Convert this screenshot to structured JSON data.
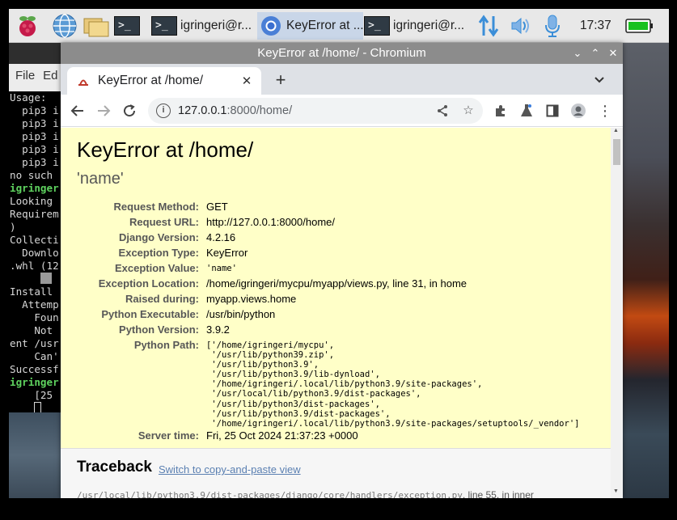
{
  "taskbar": {
    "tasks": [
      {
        "label": "igringeri@r..."
      },
      {
        "label": "KeyError at ..."
      },
      {
        "label": "igringeri@r..."
      }
    ],
    "terminal_glyph": ">_",
    "clock": "17:37"
  },
  "terminal": {
    "menu": [
      "File",
      "Ed"
    ],
    "lines": [
      {
        "text": "Usage:",
        "cls": ""
      },
      {
        "text": "  pip3 i",
        "cls": ""
      },
      {
        "text": "  pip3 i",
        "cls": ""
      },
      {
        "text": "  pip3 i",
        "cls": ""
      },
      {
        "text": "  pip3 i",
        "cls": ""
      },
      {
        "text": "  pip3 i",
        "cls": ""
      },
      {
        "text": "",
        "cls": ""
      },
      {
        "text": "no such",
        "cls": ""
      },
      {
        "text": "igringer",
        "cls": "g"
      },
      {
        "text": "Looking",
        "cls": ""
      },
      {
        "text": "Requirem",
        "cls": ""
      },
      {
        "text": ")",
        "cls": ""
      },
      {
        "text": "Collecti",
        "cls": ""
      },
      {
        "text": "  Downlo",
        "cls": ""
      },
      {
        "text": ".whl (12",
        "cls": ""
      },
      {
        "text": "     ",
        "cls": "prog"
      },
      {
        "text": "Install",
        "cls": ""
      },
      {
        "text": "  Attemp",
        "cls": ""
      },
      {
        "text": "    Foun",
        "cls": ""
      },
      {
        "text": "    Not",
        "cls": ""
      },
      {
        "text": "ent /usr",
        "cls": ""
      },
      {
        "text": "    Can'",
        "cls": ""
      },
      {
        "text": "Successf",
        "cls": ""
      },
      {
        "text": "igringer",
        "cls": "g"
      },
      {
        "text": "    [25",
        "cls": ""
      },
      {
        "text": "    ",
        "cls": "cursor"
      }
    ]
  },
  "window": {
    "title": "KeyError at /home/ - Chromium",
    "tab_title": "KeyError at /home/",
    "url_host": "127.0.0.1",
    "url_rest": ":8000/home/"
  },
  "page": {
    "title": "KeyError at /home/",
    "exception_value_head": "'name'",
    "meta": [
      {
        "key": "Request Method:",
        "value": "GET",
        "mono": false
      },
      {
        "key": "Request URL:",
        "value": "http://127.0.0.1:8000/home/",
        "mono": false
      },
      {
        "key": "Django Version:",
        "value": "4.2.16",
        "mono": false
      },
      {
        "key": "Exception Type:",
        "value": "KeyError",
        "mono": false
      },
      {
        "key": "Exception Value:",
        "value": "'name'",
        "mono": true
      },
      {
        "key": "Exception Location:",
        "value": "/home/igringeri/mycpu/myapp/views.py, line 31, in home",
        "mono": false
      },
      {
        "key": "Raised during:",
        "value": "myapp.views.home",
        "mono": false
      },
      {
        "key": "Python Executable:",
        "value": "/usr/bin/python",
        "mono": false
      },
      {
        "key": "Python Version:",
        "value": "3.9.2",
        "mono": false
      },
      {
        "key": "Python Path:",
        "value": "['/home/igringeri/mycpu',\n '/usr/lib/python39.zip',\n '/usr/lib/python3.9',\n '/usr/lib/python3.9/lib-dynload',\n '/home/igringeri/.local/lib/python3.9/site-packages',\n '/usr/local/lib/python3.9/dist-packages',\n '/usr/lib/python3/dist-packages',\n '/usr/lib/python3.9/dist-packages',\n '/home/igringeri/.local/lib/python3.9/site-packages/setuptools/_vendor']",
        "mono": true
      },
      {
        "key": "Server time:",
        "value": "Fri, 25 Oct 2024 21:37:23 +0000",
        "mono": false
      }
    ],
    "traceback_heading": "Traceback",
    "traceback_link": "Switch to copy-and-paste view",
    "first_frame_path": "/usr/local/lib/python3.9/dist-packages/django/core/handlers/exception.py",
    "first_frame_suffix": ", line 55, in inner"
  }
}
